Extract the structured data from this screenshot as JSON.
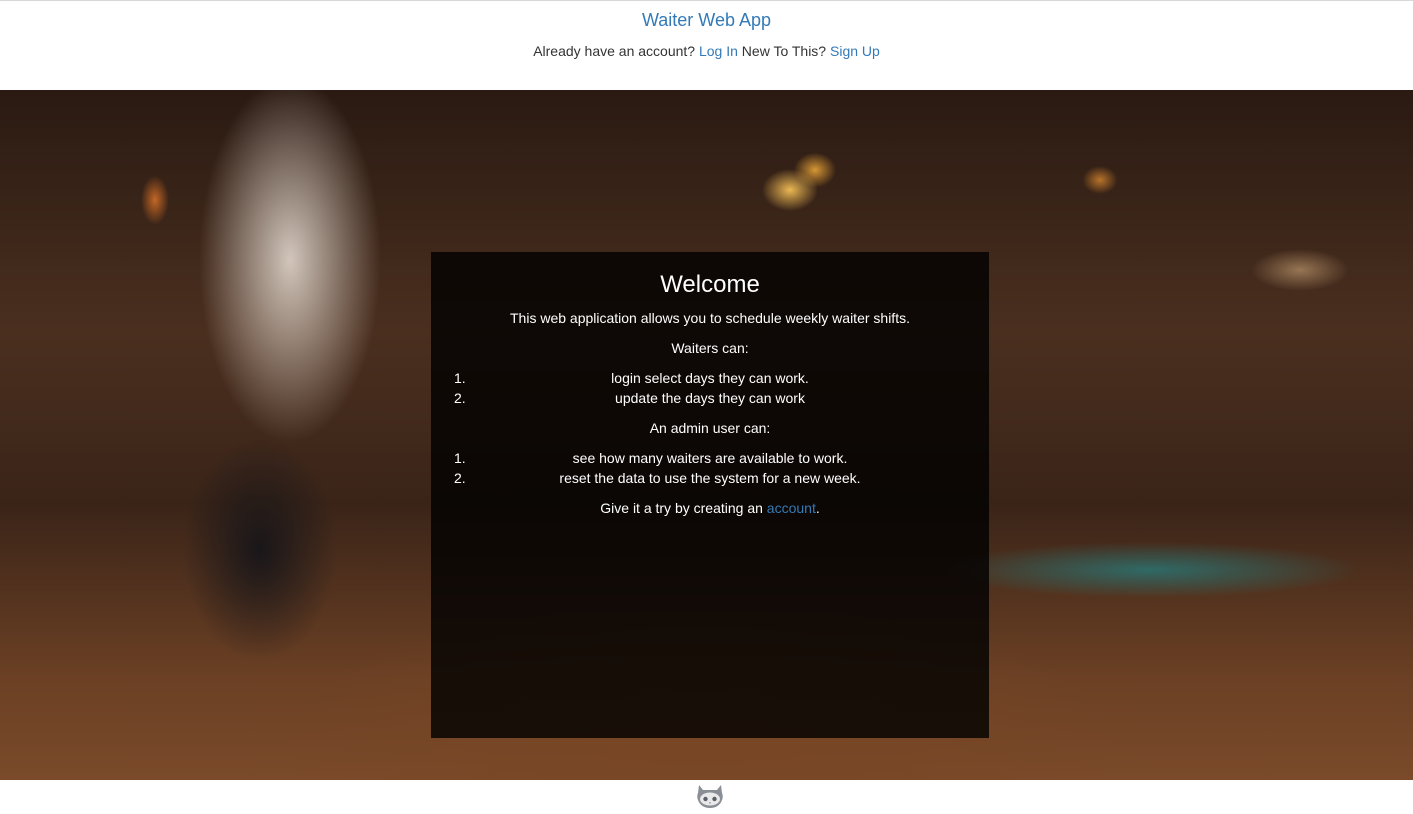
{
  "header": {
    "app_title": "Waiter Web App",
    "account_prompt": "Already have an account?",
    "login_label": "Log In",
    "new_prompt": "New To This?",
    "signup_label": "Sign Up"
  },
  "welcome": {
    "title": "Welcome",
    "intro": "This web application allows you to schedule weekly waiter shifts.",
    "waiters_heading": "Waiters can:",
    "waiters_items": [
      {
        "num": "1.",
        "text": "login select days they can work."
      },
      {
        "num": "2.",
        "text": "update the days they can work"
      }
    ],
    "admin_heading": "An admin user can:",
    "admin_items": [
      {
        "num": "1.",
        "text": "see how many waiters are available to work."
      },
      {
        "num": "2.",
        "text": "reset the data to use the system for a new week."
      }
    ],
    "cta_prefix": "Give it a try by creating an",
    "cta_link": "account",
    "cta_suffix": "."
  },
  "footer": {
    "icon": "github-octocat-icon"
  }
}
